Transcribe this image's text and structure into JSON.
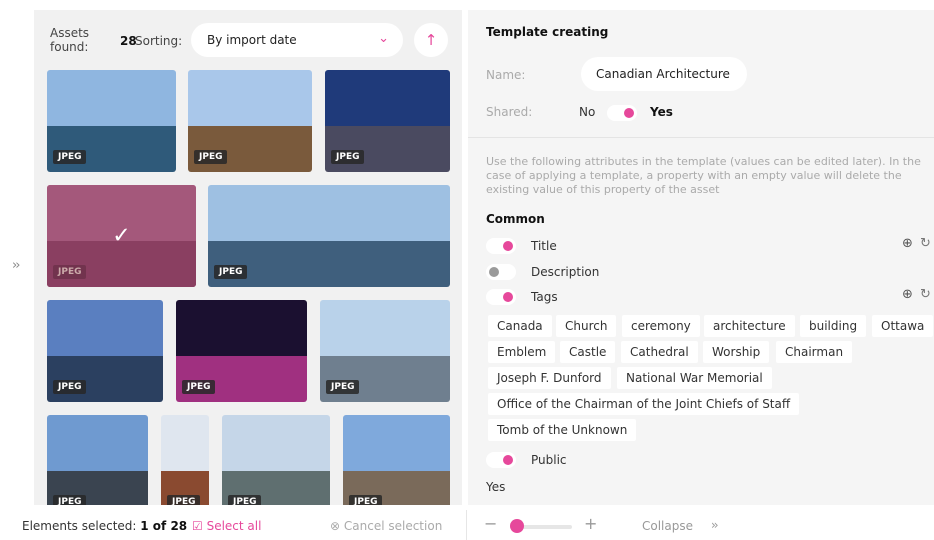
{
  "assets_panel": {
    "found_label": "Assets found:",
    "found_count": "28",
    "sorting_label": "Sorting:",
    "sort_value": "By import date",
    "thumbs": [
      {
        "badge": "JPEG",
        "sky": "#8fb6e0",
        "ground": "#2f5a7a"
      },
      {
        "badge": "JPEG",
        "sky": "#a9c7ea",
        "ground": "#7a5a3c"
      },
      {
        "badge": "JPEG",
        "sky": "#1f3a7a",
        "ground": "#4a4a60"
      },
      {
        "badge": "JPEG",
        "sky": "#c8a0b8",
        "ground": "#6d4a5a",
        "selected": true
      },
      {
        "badge": "JPEG",
        "sky": "#9ec0e2",
        "ground": "#3f5f7d"
      },
      {
        "badge": "JPEG",
        "sky": "#5a7fc0",
        "ground": "#2b4060"
      },
      {
        "badge": "JPEG",
        "sky": "#1b1030",
        "ground": "#a03080"
      },
      {
        "badge": "JPEG",
        "sky": "#b9d2ea",
        "ground": "#6f7f8f"
      },
      {
        "badge": "JPEG",
        "sky": "#6f9ad0",
        "ground": "#3a4450"
      },
      {
        "badge": "JPEG",
        "sky": "#dfe6ef",
        "ground": "#8a4a30"
      },
      {
        "badge": "JPEG",
        "sky": "#c5d6e8",
        "ground": "#5f6f70"
      },
      {
        "badge": "JPEG",
        "sky": "#7fa9dc",
        "ground": "#7a6a5a"
      }
    ]
  },
  "status": {
    "selected_prefix": "Elements selected:",
    "selected_value": "1 of 28",
    "select_all": "Select all",
    "cancel_selection": "Cancel selection",
    "zoom_minus": "−",
    "zoom_plus": "+",
    "collapse": "Collapse"
  },
  "template": {
    "title": "Template creating",
    "name_label": "Name:",
    "name_value": "Canadian Architecture",
    "shared_label": "Shared:",
    "shared_no": "No",
    "shared_yes": "Yes",
    "info": "Use the following attributes in the template (values can be edited later). In the case of applying a template, a property with an empty value will delete the existing value of this property of the asset",
    "common_heading": "Common",
    "attributes": {
      "title": "Title",
      "description": "Description",
      "tags": "Tags",
      "public": "Public"
    },
    "tags": [
      "Canada",
      "Church",
      "ceremony",
      "architecture",
      "building",
      "Ottawa",
      "Emblem",
      "Castle",
      "Cathedral",
      "Worship",
      "Chairman",
      "Joseph F. Dunford",
      "National War Memorial",
      "Office of the Chairman of the Joint Chiefs of Staff",
      "Tomb of the Unknown"
    ],
    "public_value": "Yes"
  },
  "colors": {
    "accent": "#e6489b",
    "panel": "#f1f1f1"
  }
}
